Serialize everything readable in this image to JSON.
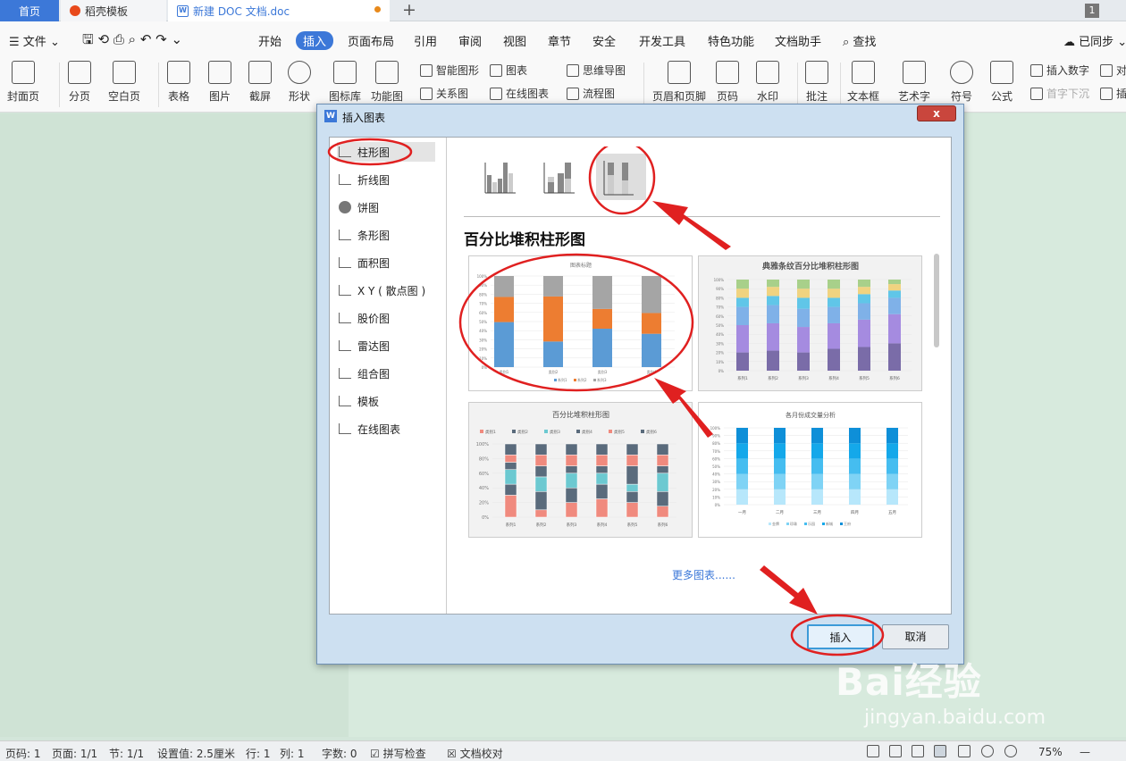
{
  "tabs": {
    "home": "首页",
    "daoke": "稻壳模板",
    "doc": "新建 DOC 文档.doc",
    "window_count": "1"
  },
  "menu": {
    "file": "文件",
    "items": [
      "开始",
      "插入",
      "页面布局",
      "引用",
      "审阅",
      "视图",
      "章节",
      "安全",
      "开发工具",
      "特色功能",
      "文档助手"
    ],
    "active": "插入",
    "search": "查找",
    "sync": "已同步"
  },
  "ribbon": {
    "big": [
      "封面页",
      "分页",
      "空白页",
      "表格",
      "图片",
      "截屏",
      "形状",
      "图标库",
      "功能图",
      "页眉和页脚",
      "页码",
      "水印",
      "批注",
      "文本框",
      "艺术字",
      "符号",
      "公式"
    ],
    "small": [
      "智能图形",
      "关系图",
      "图表",
      "在线图表",
      "思维导图",
      "流程图",
      "插入数字",
      "首字下沉",
      "对",
      "插"
    ]
  },
  "dialog": {
    "title": "插入图表",
    "close": "x",
    "categories": [
      "柱形图",
      "折线图",
      "饼图",
      "条形图",
      "面积图",
      "X Y ( 散点图 )",
      "股价图",
      "雷达图",
      "组合图",
      "模板",
      "在线图表"
    ],
    "selected_category": "柱形图",
    "section_title": "百分比堆积柱形图",
    "more": "更多图表......",
    "insert": "插入",
    "cancel": "取消",
    "cards": [
      {
        "title": "图表标题",
        "series": [
          "系列1",
          "系列2",
          "系列3"
        ],
        "colors": [
          "#5b9bd5",
          "#ed7d31",
          "#a5a5a5"
        ],
        "chart_data": {
          "type": "bar",
          "stacked": "percent",
          "categories": [
            "类别1",
            "类别2",
            "类别3",
            "类别4"
          ],
          "series": [
            {
              "name": "系列1",
              "values": [
                4.3,
                2.5,
                3.5,
                4.5
              ]
            },
            {
              "name": "系列2",
              "values": [
                2.4,
                4.4,
                1.8,
                2.8
              ]
            },
            {
              "name": "系列3",
              "values": [
                2,
                2,
                3,
                5
              ]
            }
          ]
        },
        "ticks": [
          "100%",
          "90%",
          "80%",
          "70%",
          "60%",
          "50%",
          "40%",
          "30%",
          "20%",
          "10%",
          "0%"
        ]
      },
      {
        "title": "典雅条纹百分比堆积柱形图",
        "xcats": [
          "系列1",
          "系列2",
          "系列3",
          "系列4",
          "系列5",
          "系列6"
        ],
        "ticks": [
          "100%",
          "90%",
          "80%",
          "70%",
          "60%",
          "50%",
          "40%",
          "30%",
          "20%",
          "10%",
          "0%"
        ]
      },
      {
        "title": "百分比堆积柱形图",
        "legend": [
          "类别1",
          "类别2",
          "类别3",
          "类别4",
          "类别5",
          "类别6"
        ],
        "colors": [
          "#f08a7e",
          "#5a6b7c",
          "#6cc9d1",
          "#5a6b7c",
          "#f08a7e",
          "#5a6b7c"
        ],
        "xcats": [
          "系列1",
          "系列2",
          "系列3",
          "系列4",
          "系列5",
          "系列6"
        ],
        "ticks": [
          "100%",
          "80%",
          "60%",
          "40%",
          "20%",
          "0%"
        ]
      },
      {
        "title": "各月份成交量分析",
        "xcats": [
          "一月",
          "二月",
          "三月",
          "四月",
          "五月"
        ],
        "legend": [
          "金牌",
          "珍珠",
          "乐园",
          "新城",
          "王府"
        ],
        "ticks": [
          "100%",
          "90%",
          "80%",
          "70%",
          "60%",
          "50%",
          "40%",
          "30%",
          "20%",
          "10%",
          "0%"
        ]
      }
    ]
  },
  "status": {
    "page_no": "页码: 1",
    "pages": "页面: 1/1",
    "section": "节: 1/1",
    "setting": "设置值: 2.5厘米",
    "row": "行: 1",
    "col": "列: 1",
    "words": "字数: 0",
    "spell": "拼写检查",
    "proof": "文档校对",
    "zoom": "75%"
  },
  "watermark": {
    "big": "Bai经验",
    "small": "jingyan.baidu.com"
  }
}
